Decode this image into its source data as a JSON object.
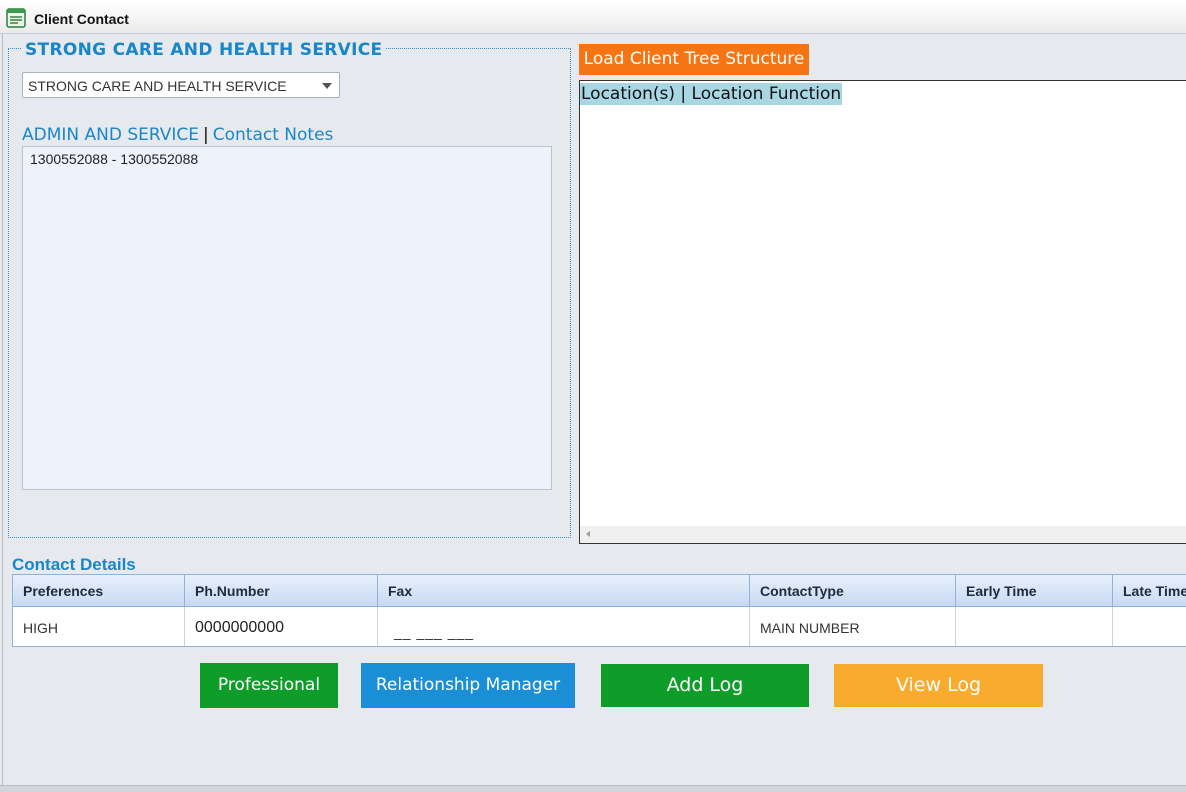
{
  "window": {
    "title": "Client Contact",
    "icon": "form-window-icon"
  },
  "client": {
    "legend": "STRONG CARE AND HEALTH SERVICE",
    "selected_client": "STRONG CARE AND HEALTH SERVICE",
    "link_admin": "ADMIN AND SERVICE",
    "link_separator": "|",
    "link_notes": "Contact Notes",
    "notes_lines": [
      "1300552088 - 1300552088"
    ]
  },
  "tree": {
    "load_button": "Load Client Tree Structure",
    "header": "Location(s) | Location Function"
  },
  "contact_details": {
    "title": "Contact Details",
    "columns": [
      "Preferences",
      "Ph.Number",
      "Fax",
      "ContactType",
      "Early Time",
      "Late Time"
    ],
    "rows": [
      {
        "preferences": "HIGH",
        "ph_number": "0000000000",
        "fax": "__ ___ ___",
        "contact_type": "MAIN NUMBER",
        "early_time": "",
        "late_time": ""
      }
    ]
  },
  "actions": {
    "professional": "Professional",
    "relationship_manager": "Relationship Manager",
    "add_log": "Add Log",
    "view_log": "View Log"
  },
  "colors": {
    "accent_blue": "#1a86c7",
    "orange": "#f57413",
    "green": "#0f9d2a",
    "button_blue": "#1a8fd6",
    "amber": "#f9ab2d"
  }
}
